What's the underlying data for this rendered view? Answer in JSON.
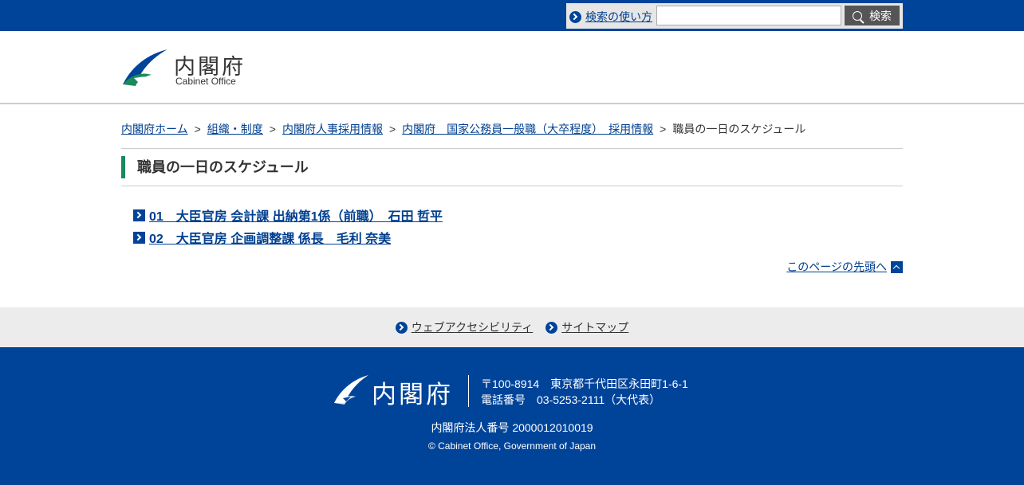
{
  "search": {
    "help_label": "検索の使い方",
    "button_label": "検索",
    "placeholder": ""
  },
  "header": {
    "logo_ja": "内閣府",
    "logo_en": "Cabinet Office",
    "colors": {
      "brand": "#00449a",
      "accent_green": "#1a8a5a"
    }
  },
  "breadcrumb": {
    "items": [
      "内閣府ホーム",
      "組織・制度",
      "内閣府人事採用情報",
      "内閣府　国家公務員一般職（大卒程度）　採用情報"
    ],
    "current": "職員の一日のスケジュール",
    "separator": ">"
  },
  "page": {
    "title": "職員の一日のスケジュール",
    "links": [
      "01　大臣官房 会計課 出納第1係（前職）　石田 哲平",
      "02　大臣官房 企画調整課 係長　毛利 奈美"
    ],
    "pagetop_label": "このページの先頭へ"
  },
  "footer_links": [
    "ウェブアクセシビリティ",
    "サイトマップ"
  ],
  "footer": {
    "logo_ja": "内閣府",
    "address": "〒100-8914　東京都千代田区永田町1-6-1",
    "phone": "電話番号　03-5253-2111（大代表）",
    "corporate_number": "内閣府法人番号 2000012010019",
    "copyright": "© Cabinet Office, Government of Japan"
  }
}
